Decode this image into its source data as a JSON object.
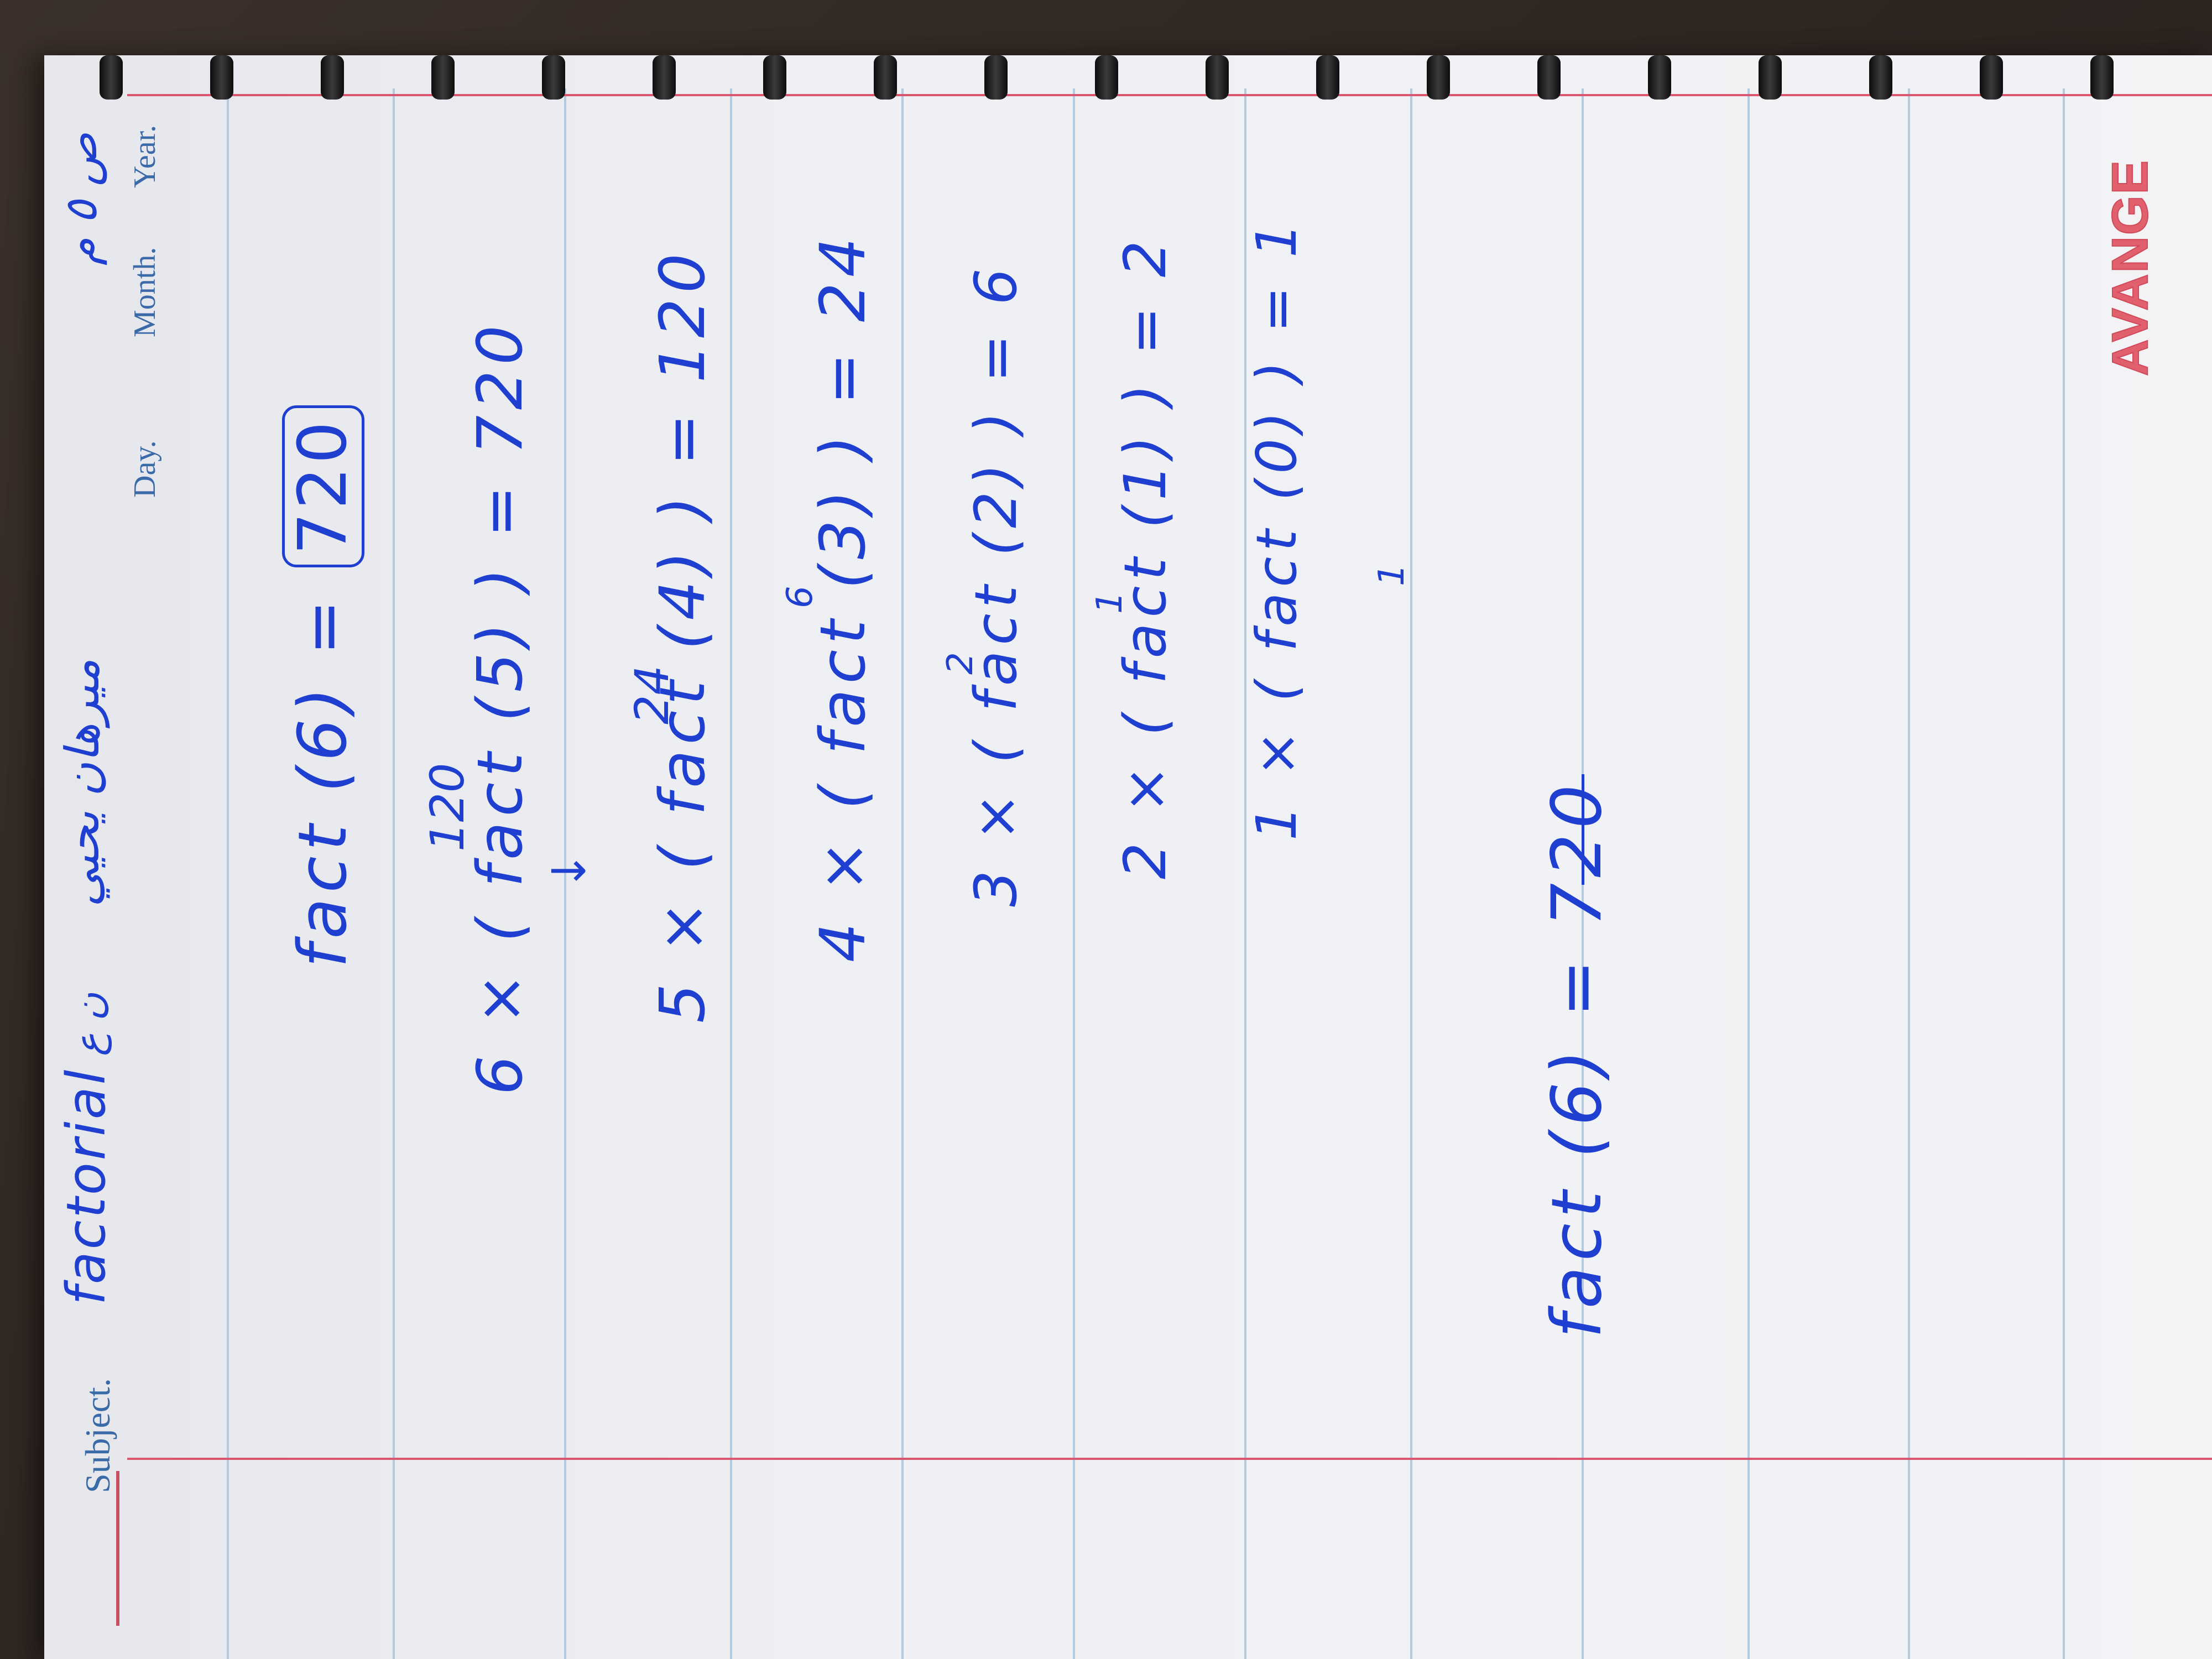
{
  "header": {
    "subject_label": "Subject.",
    "subject_value": "factorial",
    "arabic_mark": "ن ع",
    "author_name": "ميرهان يحيي",
    "day_label": "Day.",
    "month_label": "Month.",
    "year_label": "Year.",
    "corner_mark": "ص ٥ م"
  },
  "work": {
    "line1": "fact (6) =",
    "line1_result": "720",
    "note_120": "120",
    "line2": "6 × ( fact (5) ) = 720",
    "arrow": "↓",
    "note_24": "24",
    "line3": "5 × ( fact (4) ) = 120",
    "note_6": "6",
    "line4": "4 × ( fact (3) ) = 24",
    "note_2": "2",
    "line5": "3 × ( fact (2) ) = 6",
    "note_1a": "1",
    "line6": "2 × ( fact (1) ) = 2",
    "line7": "1 × ( fact (0) ) = 1",
    "note_1b": "1"
  },
  "final": {
    "line": "fact (6) = 720"
  },
  "brand": {
    "name": "AVANGE"
  },
  "colors": {
    "ink": "#1f3fd0",
    "printed": "#3b6aa8",
    "margin": "#d9566f",
    "rule": "#a9c3dc"
  }
}
